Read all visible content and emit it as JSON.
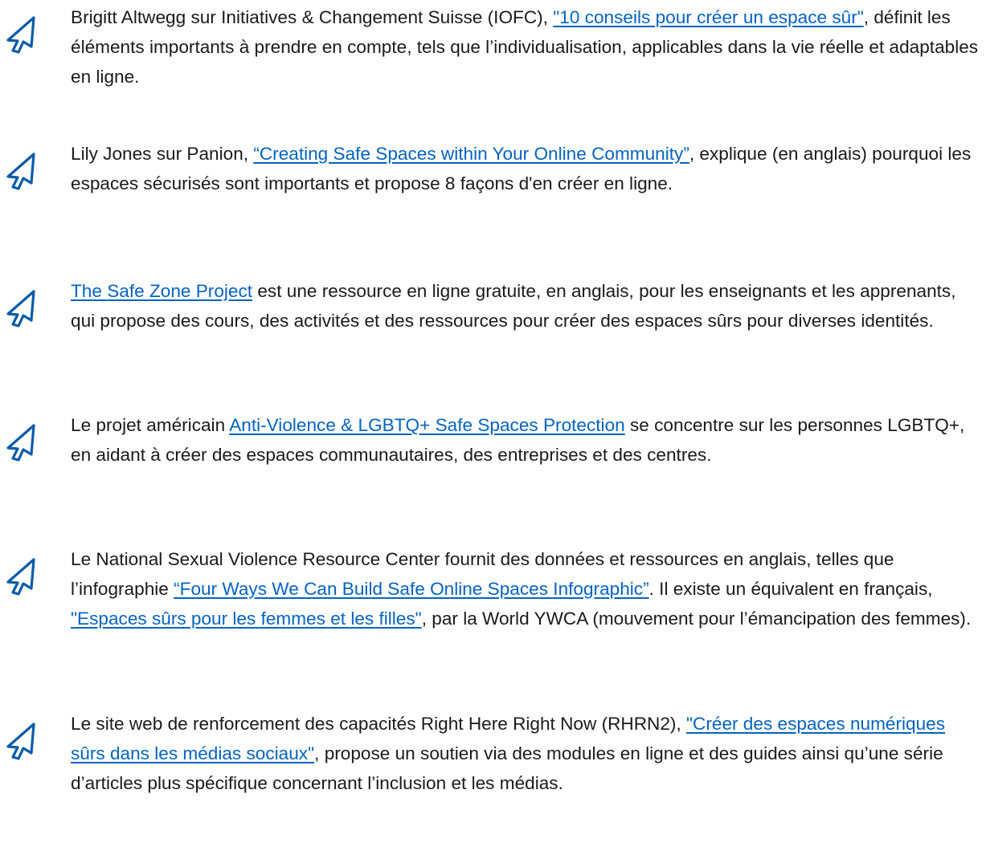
{
  "entries": [
    {
      "pre": "Brigitt Altwegg sur Initiatives & Changement Suisse (IOFC), ",
      "link1": "\"10 conseils pour créer un espace sûr\"",
      "post": ", définit les éléments importants à prendre en compte, tels que l’individualisation, applicables dans la vie réelle et adaptables en ligne."
    },
    {
      "pre": "Lily Jones sur Panion, ",
      "link1": "“Creating Safe Spaces within Your Online Community”",
      "post": ", explique (en anglais) pourquoi les espaces sécurisés sont importants et propose 8 façons d'en créer en ligne."
    },
    {
      "pre": "",
      "link1": "The Safe Zone Project",
      "post": " est une ressource en ligne gratuite, en anglais, pour les enseignants et les apprenants, qui propose des cours, des activités et des ressources pour créer des espaces sûrs pour diverses identités."
    },
    {
      "pre": "Le projet américain ",
      "link1": "Anti-Violence & LGBTQ+ Safe Spaces Protection",
      "post": " se concentre sur les personnes LGBTQ+, en aidant à créer des espaces communautaires, des entreprises et des centres."
    },
    {
      "pre": "Le National Sexual Violence Resource Center fournit des données et ressources en anglais, telles que l’infographie ",
      "link1": "“Four Ways We Can Build Safe Online Spaces Infographic”",
      "mid": ". Il existe un équivalent en français, ",
      "link2": "\"Espaces sûrs pour les femmes et les filles\"",
      "post": ", par la World YWCA (mouvement pour l’émancipation des femmes)."
    },
    {
      "pre": "Le site web de renforcement des capacités Right Here Right Now (RHRN2), ",
      "link1": "\"Créer des espaces numériques sûrs dans les médias sociaux\"",
      "post": ", propose un soutien via des modules en ligne et des guides ainsi qu’une série d’articles plus spécifique concernant l’inclusion et les médias."
    }
  ],
  "icon": {
    "name": "cursor-arrow-icon",
    "color": "#0a5ba8"
  },
  "link_color": "#0563c1"
}
